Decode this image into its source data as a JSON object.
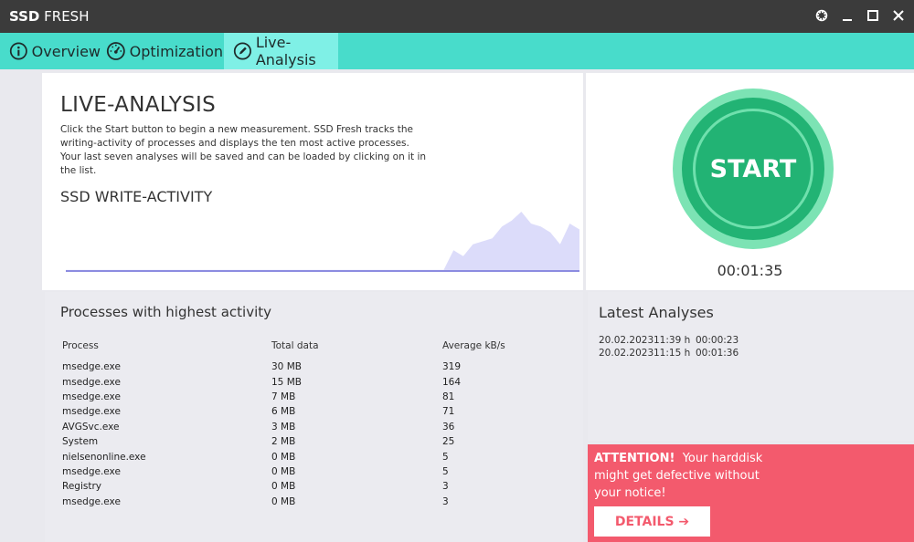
{
  "window": {
    "title_bold": "SSD",
    "title_rest": " FRESH"
  },
  "tabs": [
    {
      "label": "Overview",
      "icon": "info-icon"
    },
    {
      "label": "Optimization",
      "icon": "speedometer-icon"
    },
    {
      "label": "Live-Analysis",
      "icon": "pencil-icon",
      "active": true
    }
  ],
  "live": {
    "heading": "LIVE-ANALYSIS",
    "description": "Click the Start button to begin a new measurement. SSD Fresh tracks the writing-activity of processes and displays the ten most active processes. Your last seven analyses will be saved and can be loaded by clicking on it in the list.",
    "chart_heading": "SSD WRITE-ACTIVITY"
  },
  "start": {
    "label": "START",
    "timer": "00:01:35"
  },
  "processes": {
    "title": "Processes with highest activity",
    "headers": [
      "Process",
      "Total data",
      "Average kB/s"
    ],
    "rows": [
      [
        "msedge.exe",
        "30 MB",
        "319"
      ],
      [
        "msedge.exe",
        "15 MB",
        "164"
      ],
      [
        "msedge.exe",
        "7 MB",
        "81"
      ],
      [
        "msedge.exe",
        "6 MB",
        "71"
      ],
      [
        "AVGSvc.exe",
        "3 MB",
        "36"
      ],
      [
        "System",
        "2 MB",
        "25"
      ],
      [
        "nielsenonline.exe",
        "0 MB",
        "5"
      ],
      [
        "msedge.exe",
        "0 MB",
        "5"
      ],
      [
        "Registry",
        "0 MB",
        "3"
      ],
      [
        "msedge.exe",
        "0 MB",
        "3"
      ]
    ]
  },
  "latest": {
    "title": "Latest Analyses",
    "items": [
      {
        "date": "20.02.2023",
        "time": "11:39 h",
        "duration": "00:00:23"
      },
      {
        "date": "20.02.2023",
        "time": "11:15 h",
        "duration": "00:01:36"
      }
    ]
  },
  "attention": {
    "label": "ATTENTION!",
    "message": "Your harddisk might get defective without your notice!",
    "button_label": "DETAILS ➔"
  },
  "colors": {
    "titlebar": "#3b3b3b",
    "tabbar": "#48dccb",
    "active_tab": "#7ff0e6",
    "start_green": "#22b374",
    "attention_red": "#f35a6d",
    "chart_fill": "#dcdcfa",
    "chart_line": "#8c8ce0"
  },
  "write_activity_relative": [
    0.02,
    0.02,
    0.02,
    0.02,
    0.02,
    0.02,
    0.02,
    0.02,
    0.02,
    0.02,
    0.02,
    0.02,
    0.02,
    0.02,
    0.02,
    0.02,
    0.02,
    0.02,
    0.02,
    0.02,
    0.02,
    0.02,
    0.02,
    0.02,
    0.02,
    0.02,
    0.02,
    0.02,
    0.02,
    0.02,
    0.02,
    0.02,
    0.02,
    0.02,
    0.02,
    0.02,
    0.02,
    0.02,
    0.02,
    0.02,
    0.35,
    0.25,
    0.45,
    0.5,
    0.55,
    0.75,
    0.85,
    1.0,
    0.8,
    0.75,
    0.65,
    0.45,
    0.8,
    0.7
  ]
}
